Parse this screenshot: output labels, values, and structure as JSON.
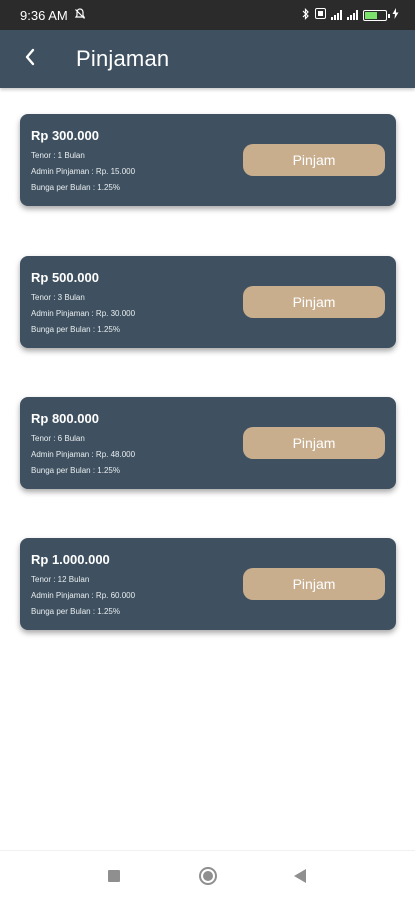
{
  "status_bar": {
    "time": "9:36 AM",
    "icons": [
      "notification-off-icon",
      "bluetooth-icon",
      "volte-icon",
      "signal-icon",
      "signal-icon",
      "battery-icon",
      "charging-icon"
    ]
  },
  "app_bar": {
    "back_icon": "chevron-left-icon",
    "title": "Pinjaman"
  },
  "loans": [
    {
      "amount": "Rp 300.000",
      "tenor": "Tenor : 1 Bulan",
      "admin": "Admin Pinjaman : Rp. 15.000",
      "bunga": "Bunga per Bulan : 1.25%",
      "button_label": "Pinjam"
    },
    {
      "amount": "Rp 500.000",
      "tenor": "Tenor : 3 Bulan",
      "admin": "Admin Pinjaman : Rp. 30.000",
      "bunga": "Bunga per Bulan : 1.25%",
      "button_label": "Pinjam"
    },
    {
      "amount": "Rp 800.000",
      "tenor": "Tenor : 6 Bulan",
      "admin": "Admin Pinjaman : Rp. 48.000",
      "bunga": "Bunga per Bulan : 1.25%",
      "button_label": "Pinjam"
    },
    {
      "amount": "Rp 1.000.000",
      "tenor": "Tenor : 12 Bulan",
      "admin": "Admin Pinjaman : Rp. 60.000",
      "bunga": "Bunga per Bulan : 1.25%",
      "button_label": "Pinjam"
    }
  ],
  "nav_bar": {
    "icons": [
      "recent-apps-icon",
      "home-icon",
      "back-icon"
    ]
  },
  "colors": {
    "primary": "#3f5160",
    "button": "#c9ae8e",
    "status_bar": "#2b2b2b"
  }
}
